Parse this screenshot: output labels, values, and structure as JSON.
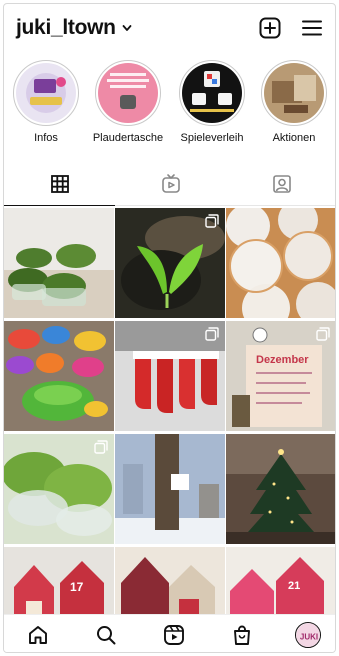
{
  "header": {
    "username": "juki_ltown",
    "icons": [
      "chevron-down-icon",
      "plus-square-icon",
      "menu-icon"
    ]
  },
  "highlights": [
    {
      "label": "Infos"
    },
    {
      "label": "Plaudertasche"
    },
    {
      "label": "Spieleverleih"
    },
    {
      "label": "Aktionen"
    }
  ],
  "tabs": [
    "grid-icon",
    "reels-icon",
    "tagged-icon"
  ],
  "posts": {
    "texts": {
      "poster_title": "Dezember",
      "calendar_number_1": "17",
      "calendar_number_2": "21"
    }
  },
  "bottom_nav": {
    "icons": [
      "home-icon",
      "search-icon",
      "reels-icon",
      "shop-icon"
    ],
    "avatar_text": "JUKI"
  },
  "colors": {
    "accent": "#111111",
    "story_ring": "#c9c9c9",
    "divider": "#e6e6e6"
  }
}
